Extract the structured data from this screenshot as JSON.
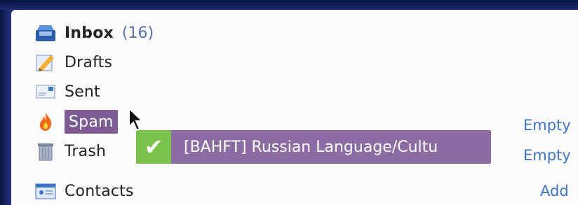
{
  "folders": {
    "inbox": {
      "label": "Inbox",
      "count": "(16)"
    },
    "drafts": {
      "label": "Drafts"
    },
    "sent": {
      "label": "Sent"
    },
    "spam": {
      "label": "Spam",
      "action": "Empty"
    },
    "trash": {
      "label": "Trash",
      "action": "Empty"
    },
    "contacts": {
      "label": "Contacts",
      "action": "Add"
    }
  },
  "drag": {
    "check": "✔",
    "text": "[BAHFT] Russian Language/Cultu"
  },
  "colors": {
    "highlight": "#7f5b94",
    "drag_bg": "#8d6ba3",
    "check_bg": "#79c34b",
    "link": "#3f73c3",
    "count": "#5a6fae"
  },
  "icons": [
    "inbox-tray-icon",
    "drafts-pencil-icon",
    "sent-envelope-icon",
    "spam-flame-icon",
    "trash-can-icon",
    "contacts-card-icon",
    "mouse-pointer-icon"
  ]
}
